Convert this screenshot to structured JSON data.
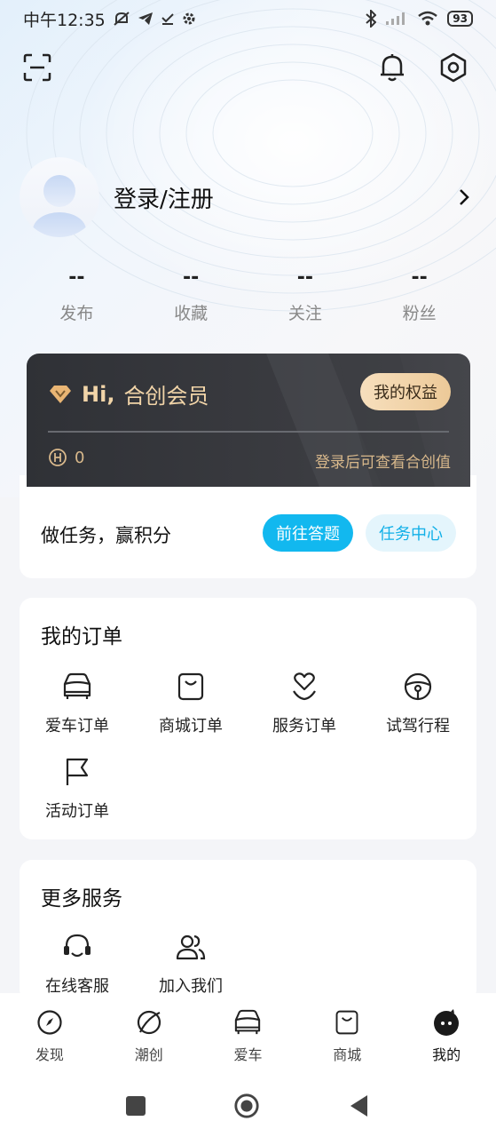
{
  "status_bar": {
    "time": "中午12:35",
    "battery": "93"
  },
  "profile": {
    "login_text": "登录/注册"
  },
  "stats": [
    {
      "value": "--",
      "label": "发布"
    },
    {
      "value": "--",
      "label": "收藏"
    },
    {
      "value": "--",
      "label": "关注"
    },
    {
      "value": "--",
      "label": "粉丝"
    }
  ],
  "vip": {
    "hi": "Hi,",
    "title": "合创会员",
    "benefits_button": "我的权益",
    "points": "0",
    "hint": "登录后可查看合创值"
  },
  "task": {
    "text": "做任务，赢积分",
    "quiz_button": "前往答题",
    "center_button": "任务中心"
  },
  "orders": {
    "title": "我的订单",
    "items": [
      {
        "label": "爱车订单",
        "icon": "car-icon"
      },
      {
        "label": "商城订单",
        "icon": "shopping-bag-icon"
      },
      {
        "label": "服务订单",
        "icon": "heart-hand-icon"
      },
      {
        "label": "试驾行程",
        "icon": "steering-wheel-icon"
      },
      {
        "label": "活动订单",
        "icon": "flag-icon"
      }
    ]
  },
  "services": {
    "title": "更多服务",
    "items": [
      {
        "label": "在线客服",
        "icon": "headset-icon"
      },
      {
        "label": "加入我们",
        "icon": "users-icon"
      }
    ]
  },
  "tabbar": [
    {
      "label": "发现",
      "icon": "compass-icon"
    },
    {
      "label": "潮创",
      "icon": "planet-icon"
    },
    {
      "label": "爱车",
      "icon": "car-icon"
    },
    {
      "label": "商城",
      "icon": "shopping-bag-icon"
    },
    {
      "label": "我的",
      "icon": "mascot-icon",
      "active": true
    }
  ],
  "colors": {
    "primary": "#12b8ef",
    "vip_gold": "#f1d4a8",
    "vip_dark": "#2f3136"
  }
}
